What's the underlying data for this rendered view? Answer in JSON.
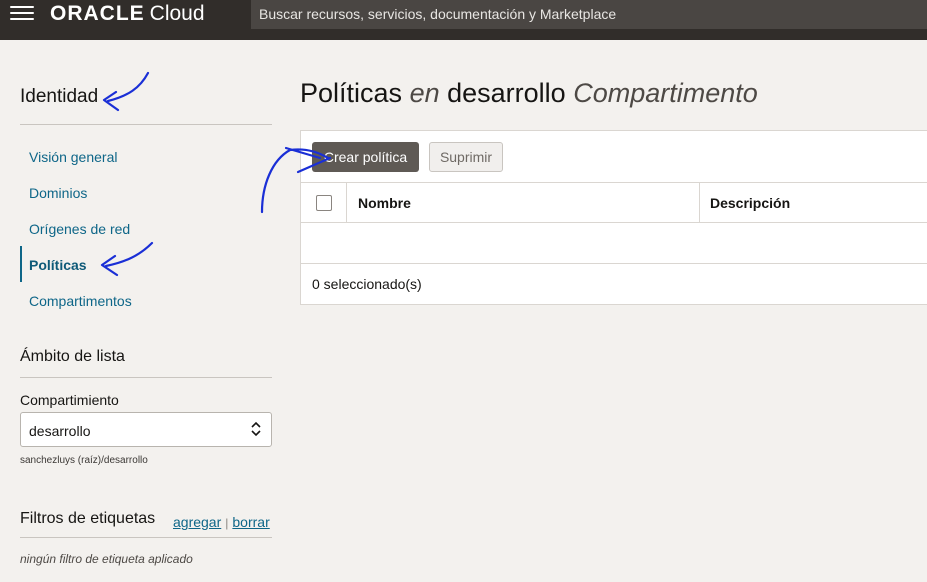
{
  "topbar": {
    "logo_oracle": "ORACLE",
    "logo_cloud": "Cloud",
    "search_placeholder": "Buscar recursos, servicios, documentación y Marketplace"
  },
  "sidebar": {
    "title": "Identidad",
    "items": [
      {
        "label": "Visión general",
        "active": false
      },
      {
        "label": "Dominios",
        "active": false
      },
      {
        "label": "Orígenes de red",
        "active": false
      },
      {
        "label": "Políticas",
        "active": true
      },
      {
        "label": "Compartimentos",
        "active": false
      }
    ],
    "scope_title": "Ámbito de lista",
    "compartment_label": "Compartimiento",
    "compartment_value": "desarrollo",
    "compartment_path": "sanchezluys (raíz)/desarrollo",
    "filters_title": "Filtros de etiquetas",
    "filters_add": "agregar",
    "filters_sep": "|",
    "filters_clear": "borrar",
    "filters_empty": "ningún filtro de etiqueta aplicado"
  },
  "main": {
    "title_word1": "Políticas",
    "title_word2": "en",
    "title_word3": "desarrollo",
    "title_word4": "Compartimento",
    "create_button": "Crear política",
    "delete_button": "Suprimir",
    "columns": [
      "Nombre",
      "Descripción"
    ],
    "rows": [],
    "selected_count": "0 seleccionado(s)"
  },
  "colors": {
    "topbar_bg": "#312d2a",
    "link": "#0e6688",
    "primary_button": "#5f5a55",
    "annotation": "#1a2fd6"
  }
}
